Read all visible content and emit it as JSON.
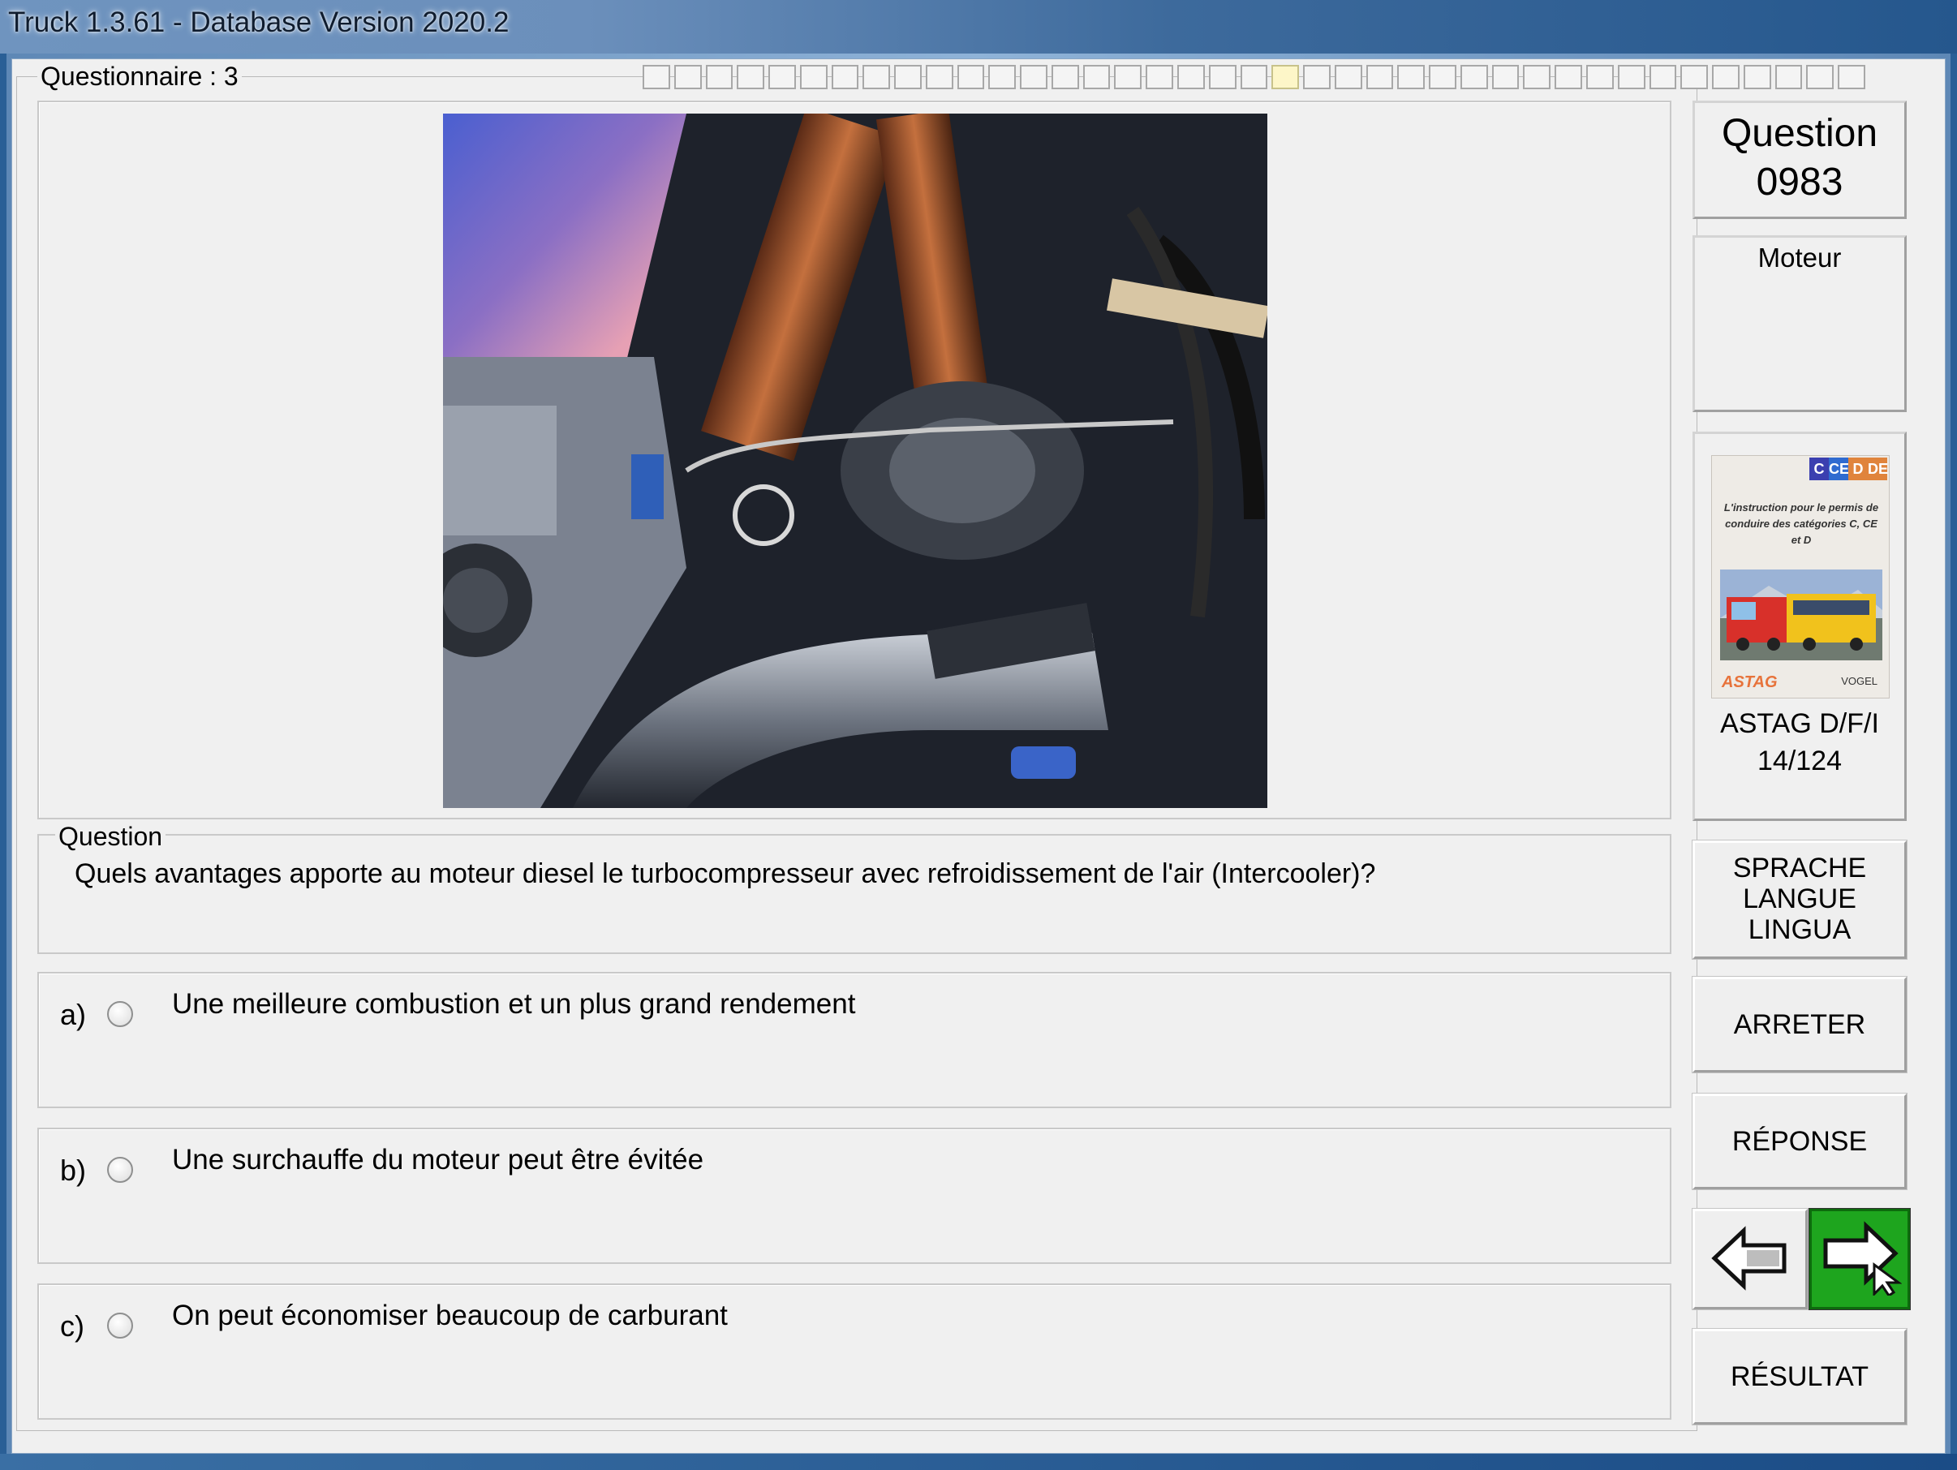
{
  "window": {
    "title": "Truck 1.3.61 - Database Version 2020.2"
  },
  "questionnaire": {
    "legend": "Questionnaire : 3",
    "progress_total": 39,
    "progress_current": 21
  },
  "question": {
    "number_label": "Question",
    "number": "0983",
    "category": "Moteur",
    "legend": "Question",
    "text": "Quels avantages apporte au moteur diesel le turbocompresseur avec refroidissement de l'air (Intercooler)?"
  },
  "answers": [
    {
      "letter": "a)",
      "text": "Une meilleure combustion et un plus grand rendement"
    },
    {
      "letter": "b)",
      "text": "Une surchauffe du moteur peut être évitée"
    },
    {
      "letter": "c)",
      "text": "On peut économiser beaucoup de carburant"
    }
  ],
  "book": {
    "cover_categories": [
      "C",
      "CE",
      "D",
      "DE"
    ],
    "cover_category_colors": [
      "#3b3fb0",
      "#2f6bd0",
      "#e0843c",
      "#e0843c"
    ],
    "cover_text": "L'instruction pour le permis de conduire des catégories C, CE et D",
    "cover_logo_left": "ASTAG",
    "cover_logo_right": "VOGEL",
    "source": "ASTAG D/F/I",
    "page": "14/124"
  },
  "buttons": {
    "lang_line1": "SPRACHE",
    "lang_line2": "LANGUE",
    "lang_line3": "LINGUA",
    "stop": "ARRETER",
    "answer": "RÉPONSE",
    "result": "RÉSULTAT",
    "prev_icon": "arrow-left-icon",
    "next_icon": "arrow-right-icon"
  },
  "colors": {
    "next_button": "#1ea51e",
    "title_bar": "#6f94bf"
  }
}
